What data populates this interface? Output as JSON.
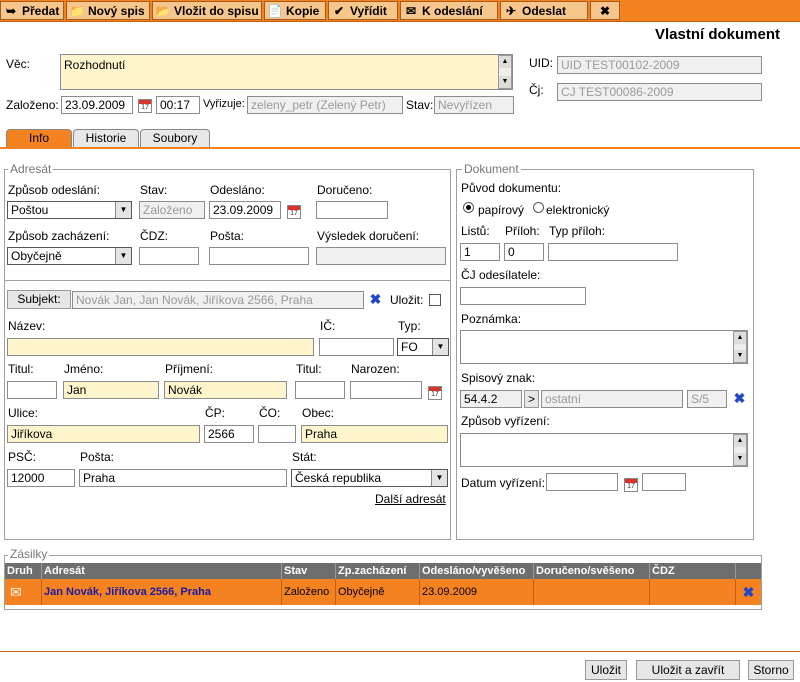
{
  "toolbar": {
    "items": [
      {
        "label": "Předat",
        "icon": "forward-icon"
      },
      {
        "label": "Nový spis",
        "icon": "folder-icon"
      },
      {
        "label": "Vložit do spisu",
        "icon": "insert-icon"
      },
      {
        "label": "Kopie",
        "icon": "copy-icon"
      },
      {
        "label": "Vyřídit",
        "icon": "check-icon"
      },
      {
        "label": "K odeslání",
        "icon": "prepare-send-icon"
      },
      {
        "label": "Odeslat",
        "icon": "send-icon"
      },
      {
        "label": "",
        "icon": "close-icon"
      }
    ]
  },
  "page_title": "Vlastní dokument",
  "header": {
    "vec_label": "Věc:",
    "vec_value": "Rozhodnutí",
    "uid_label": "UID:",
    "uid_value": "UID TEST00102-2009",
    "cj_label": "Čj:",
    "cj_value": "CJ TEST00086-2009",
    "zalozeno_label": "Založeno:",
    "zalozeno_date": "23.09.2009",
    "zalozeno_time": "00:17",
    "vyrizuje_label": "Vyřizuje:",
    "vyrizuje_value": "zeleny_petr (Zelený Petr)",
    "stav_label": "Stav:",
    "stav_value": "Nevyřízen"
  },
  "tabs": [
    {
      "label": "Info",
      "active": true
    },
    {
      "label": "Historie",
      "active": false
    },
    {
      "label": "Soubory",
      "active": false
    }
  ],
  "adresat": {
    "legend": "Adresát",
    "zpusob_odeslani_label": "Způsob odeslání:",
    "zpusob_odeslani_value": "Poštou",
    "stav_label": "Stav:",
    "stav_value": "Založeno",
    "odeslano_label": "Odesláno:",
    "odeslano_value": "23.09.2009",
    "doruceno_label": "Doručeno:",
    "doruceno_value": "",
    "zpusob_zachazeni_label": "Způsob zacházení:",
    "zpusob_zachazeni_value": "Obyčejně",
    "cdz_label": "ČDZ:",
    "posta_label": "Pošta:",
    "vysledek_label": "Výsledek doručení:",
    "subjekt_button": "Subjekt:",
    "subjekt_value": "Novák Jan, Jan Novák, Jiříkova 2566, Praha",
    "ulozit_label": "Uložit:",
    "nazev_label": "Název:",
    "ic_label": "IČ:",
    "typ_label": "Typ:",
    "typ_value": "FO",
    "titul_label": "Titul:",
    "jmeno_label": "Jméno:",
    "jmeno_value": "Jan",
    "prijmeni_label": "Příjmení:",
    "prijmeni_value": "Novák",
    "titul2_label": "Titul:",
    "narozen_label": "Narozen:",
    "ulice_label": "Ulice:",
    "ulice_value": "Jiříkova",
    "cp_label": "ČP:",
    "cp_value": "2566",
    "co_label": "ČO:",
    "obec_label": "Obec:",
    "obec_value": "Praha",
    "psc_label": "PSČ:",
    "psc_value": "12000",
    "posta2_label": "Pošta:",
    "posta2_value": "Praha",
    "stat_label": "Stát:",
    "stat_value": "Česká republika",
    "dalsi_adresat": "Další adresát"
  },
  "dokument": {
    "legend": "Dokument",
    "puvod_label": "Původ dokumentu:",
    "papirovy_label": "papírový",
    "elektronicky_label": "elektronický",
    "listu_label": "Listů:",
    "listu_value": "1",
    "priloh_label": "Příloh:",
    "priloh_value": "0",
    "typ_priloh_label": "Typ příloh:",
    "cj_odesilatele_label": "ČJ odesílatele:",
    "poznamka_label": "Poznámka:",
    "spisovy_znak_label": "Spisový znak:",
    "spisovy_znak_value": "54.4.2",
    "spisovy_znak_arrow": ">",
    "spisovy_znak_desc": "ostatní",
    "spisovy_znak_code": "S/5",
    "zpusob_vyrizeni_label": "Způsob vyřízení:",
    "datum_vyrizeni_label": "Datum vyřízení:"
  },
  "zasilky": {
    "legend": "Zásilky",
    "columns": [
      "Druh",
      "Adresát",
      "Stav",
      "Zp.zacházení",
      "Odesláno/vyvěšeno",
      "Doručeno/svěšeno",
      "ČDZ",
      ""
    ],
    "rows": [
      {
        "adresat": "Jan Novák, Jiříkova 2566, Praha",
        "stav": "Založeno",
        "zachazeni": "Obyčejně",
        "odeslano": "23.09.2009",
        "doruceno": "",
        "cdz": ""
      }
    ]
  },
  "footer": {
    "ulozit": "Uložit",
    "ulozit_zavrit": "Uložit a zavřít",
    "storno": "Storno"
  },
  "colors": {
    "accent": "#f58220",
    "toolbar_button": "#f7c68c",
    "yellow_input": "#fff5cc",
    "row_text": "#1a1aa6",
    "delete_x": "#2047c8"
  }
}
